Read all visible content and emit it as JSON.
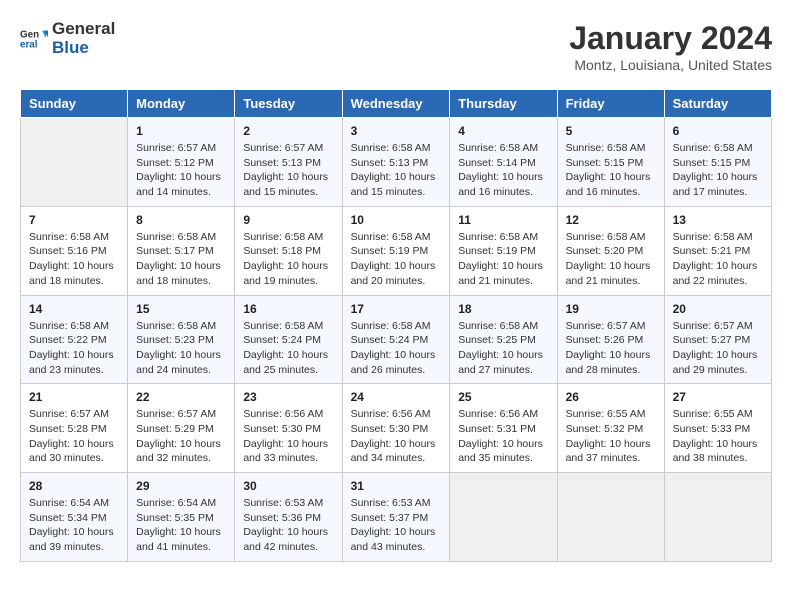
{
  "header": {
    "logo_line1": "General",
    "logo_line2": "Blue",
    "month": "January 2024",
    "location": "Montz, Louisiana, United States"
  },
  "days_of_week": [
    "Sunday",
    "Monday",
    "Tuesday",
    "Wednesday",
    "Thursday",
    "Friday",
    "Saturday"
  ],
  "weeks": [
    [
      {
        "num": "",
        "empty": true
      },
      {
        "num": "1",
        "sunrise": "6:57 AM",
        "sunset": "5:12 PM",
        "daylight": "10 hours and 14 minutes."
      },
      {
        "num": "2",
        "sunrise": "6:57 AM",
        "sunset": "5:13 PM",
        "daylight": "10 hours and 15 minutes."
      },
      {
        "num": "3",
        "sunrise": "6:58 AM",
        "sunset": "5:13 PM",
        "daylight": "10 hours and 15 minutes."
      },
      {
        "num": "4",
        "sunrise": "6:58 AM",
        "sunset": "5:14 PM",
        "daylight": "10 hours and 16 minutes."
      },
      {
        "num": "5",
        "sunrise": "6:58 AM",
        "sunset": "5:15 PM",
        "daylight": "10 hours and 16 minutes."
      },
      {
        "num": "6",
        "sunrise": "6:58 AM",
        "sunset": "5:15 PM",
        "daylight": "10 hours and 17 minutes."
      }
    ],
    [
      {
        "num": "7",
        "sunrise": "6:58 AM",
        "sunset": "5:16 PM",
        "daylight": "10 hours and 18 minutes."
      },
      {
        "num": "8",
        "sunrise": "6:58 AM",
        "sunset": "5:17 PM",
        "daylight": "10 hours and 18 minutes."
      },
      {
        "num": "9",
        "sunrise": "6:58 AM",
        "sunset": "5:18 PM",
        "daylight": "10 hours and 19 minutes."
      },
      {
        "num": "10",
        "sunrise": "6:58 AM",
        "sunset": "5:19 PM",
        "daylight": "10 hours and 20 minutes."
      },
      {
        "num": "11",
        "sunrise": "6:58 AM",
        "sunset": "5:19 PM",
        "daylight": "10 hours and 21 minutes."
      },
      {
        "num": "12",
        "sunrise": "6:58 AM",
        "sunset": "5:20 PM",
        "daylight": "10 hours and 21 minutes."
      },
      {
        "num": "13",
        "sunrise": "6:58 AM",
        "sunset": "5:21 PM",
        "daylight": "10 hours and 22 minutes."
      }
    ],
    [
      {
        "num": "14",
        "sunrise": "6:58 AM",
        "sunset": "5:22 PM",
        "daylight": "10 hours and 23 minutes."
      },
      {
        "num": "15",
        "sunrise": "6:58 AM",
        "sunset": "5:23 PM",
        "daylight": "10 hours and 24 minutes."
      },
      {
        "num": "16",
        "sunrise": "6:58 AM",
        "sunset": "5:24 PM",
        "daylight": "10 hours and 25 minutes."
      },
      {
        "num": "17",
        "sunrise": "6:58 AM",
        "sunset": "5:24 PM",
        "daylight": "10 hours and 26 minutes."
      },
      {
        "num": "18",
        "sunrise": "6:58 AM",
        "sunset": "5:25 PM",
        "daylight": "10 hours and 27 minutes."
      },
      {
        "num": "19",
        "sunrise": "6:57 AM",
        "sunset": "5:26 PM",
        "daylight": "10 hours and 28 minutes."
      },
      {
        "num": "20",
        "sunrise": "6:57 AM",
        "sunset": "5:27 PM",
        "daylight": "10 hours and 29 minutes."
      }
    ],
    [
      {
        "num": "21",
        "sunrise": "6:57 AM",
        "sunset": "5:28 PM",
        "daylight": "10 hours and 30 minutes."
      },
      {
        "num": "22",
        "sunrise": "6:57 AM",
        "sunset": "5:29 PM",
        "daylight": "10 hours and 32 minutes."
      },
      {
        "num": "23",
        "sunrise": "6:56 AM",
        "sunset": "5:30 PM",
        "daylight": "10 hours and 33 minutes."
      },
      {
        "num": "24",
        "sunrise": "6:56 AM",
        "sunset": "5:30 PM",
        "daylight": "10 hours and 34 minutes."
      },
      {
        "num": "25",
        "sunrise": "6:56 AM",
        "sunset": "5:31 PM",
        "daylight": "10 hours and 35 minutes."
      },
      {
        "num": "26",
        "sunrise": "6:55 AM",
        "sunset": "5:32 PM",
        "daylight": "10 hours and 37 minutes."
      },
      {
        "num": "27",
        "sunrise": "6:55 AM",
        "sunset": "5:33 PM",
        "daylight": "10 hours and 38 minutes."
      }
    ],
    [
      {
        "num": "28",
        "sunrise": "6:54 AM",
        "sunset": "5:34 PM",
        "daylight": "10 hours and 39 minutes."
      },
      {
        "num": "29",
        "sunrise": "6:54 AM",
        "sunset": "5:35 PM",
        "daylight": "10 hours and 41 minutes."
      },
      {
        "num": "30",
        "sunrise": "6:53 AM",
        "sunset": "5:36 PM",
        "daylight": "10 hours and 42 minutes."
      },
      {
        "num": "31",
        "sunrise": "6:53 AM",
        "sunset": "5:37 PM",
        "daylight": "10 hours and 43 minutes."
      },
      {
        "num": "",
        "empty": true
      },
      {
        "num": "",
        "empty": true
      },
      {
        "num": "",
        "empty": true
      }
    ]
  ],
  "labels": {
    "sunrise": "Sunrise:",
    "sunset": "Sunset:",
    "daylight": "Daylight:"
  }
}
